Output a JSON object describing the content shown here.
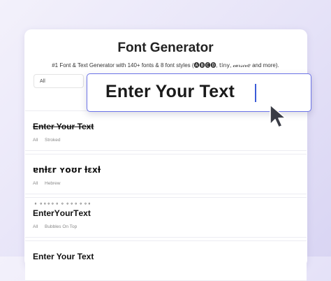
{
  "header": {
    "title": "Font Generator",
    "subtitle": "#1 Font & Text Generator with 140+ fonts & 8 font styles (🅐🅑🅒🅓, 𝗍𝗂𝗇𝗒, 𝒸𝓊𝓇𝓈𝒾𝓋ℯ and more)."
  },
  "filter": {
    "selected": "All"
  },
  "search": {
    "value": "Enter Your Text"
  },
  "results": [
    {
      "sample": "Enter Your Text",
      "tags": [
        "All",
        "Stroked"
      ],
      "style": "stroked"
    },
    {
      "sample": "ɐnƚɛr ʏoʊr ƚɛxƚ",
      "tags": [
        "All",
        "Hebrew"
      ],
      "style": "hebrew"
    },
    {
      "sample": "Enter Your Text",
      "tags": [
        "All",
        "Bubbles On Top"
      ],
      "style": "bubbles"
    },
    {
      "sample": "Enter Your Text",
      "tags": [],
      "style": "plain"
    }
  ],
  "colors": {
    "accent": "#6c74e8",
    "caret": "#3b5bd8",
    "background": "#e6e3f8"
  }
}
